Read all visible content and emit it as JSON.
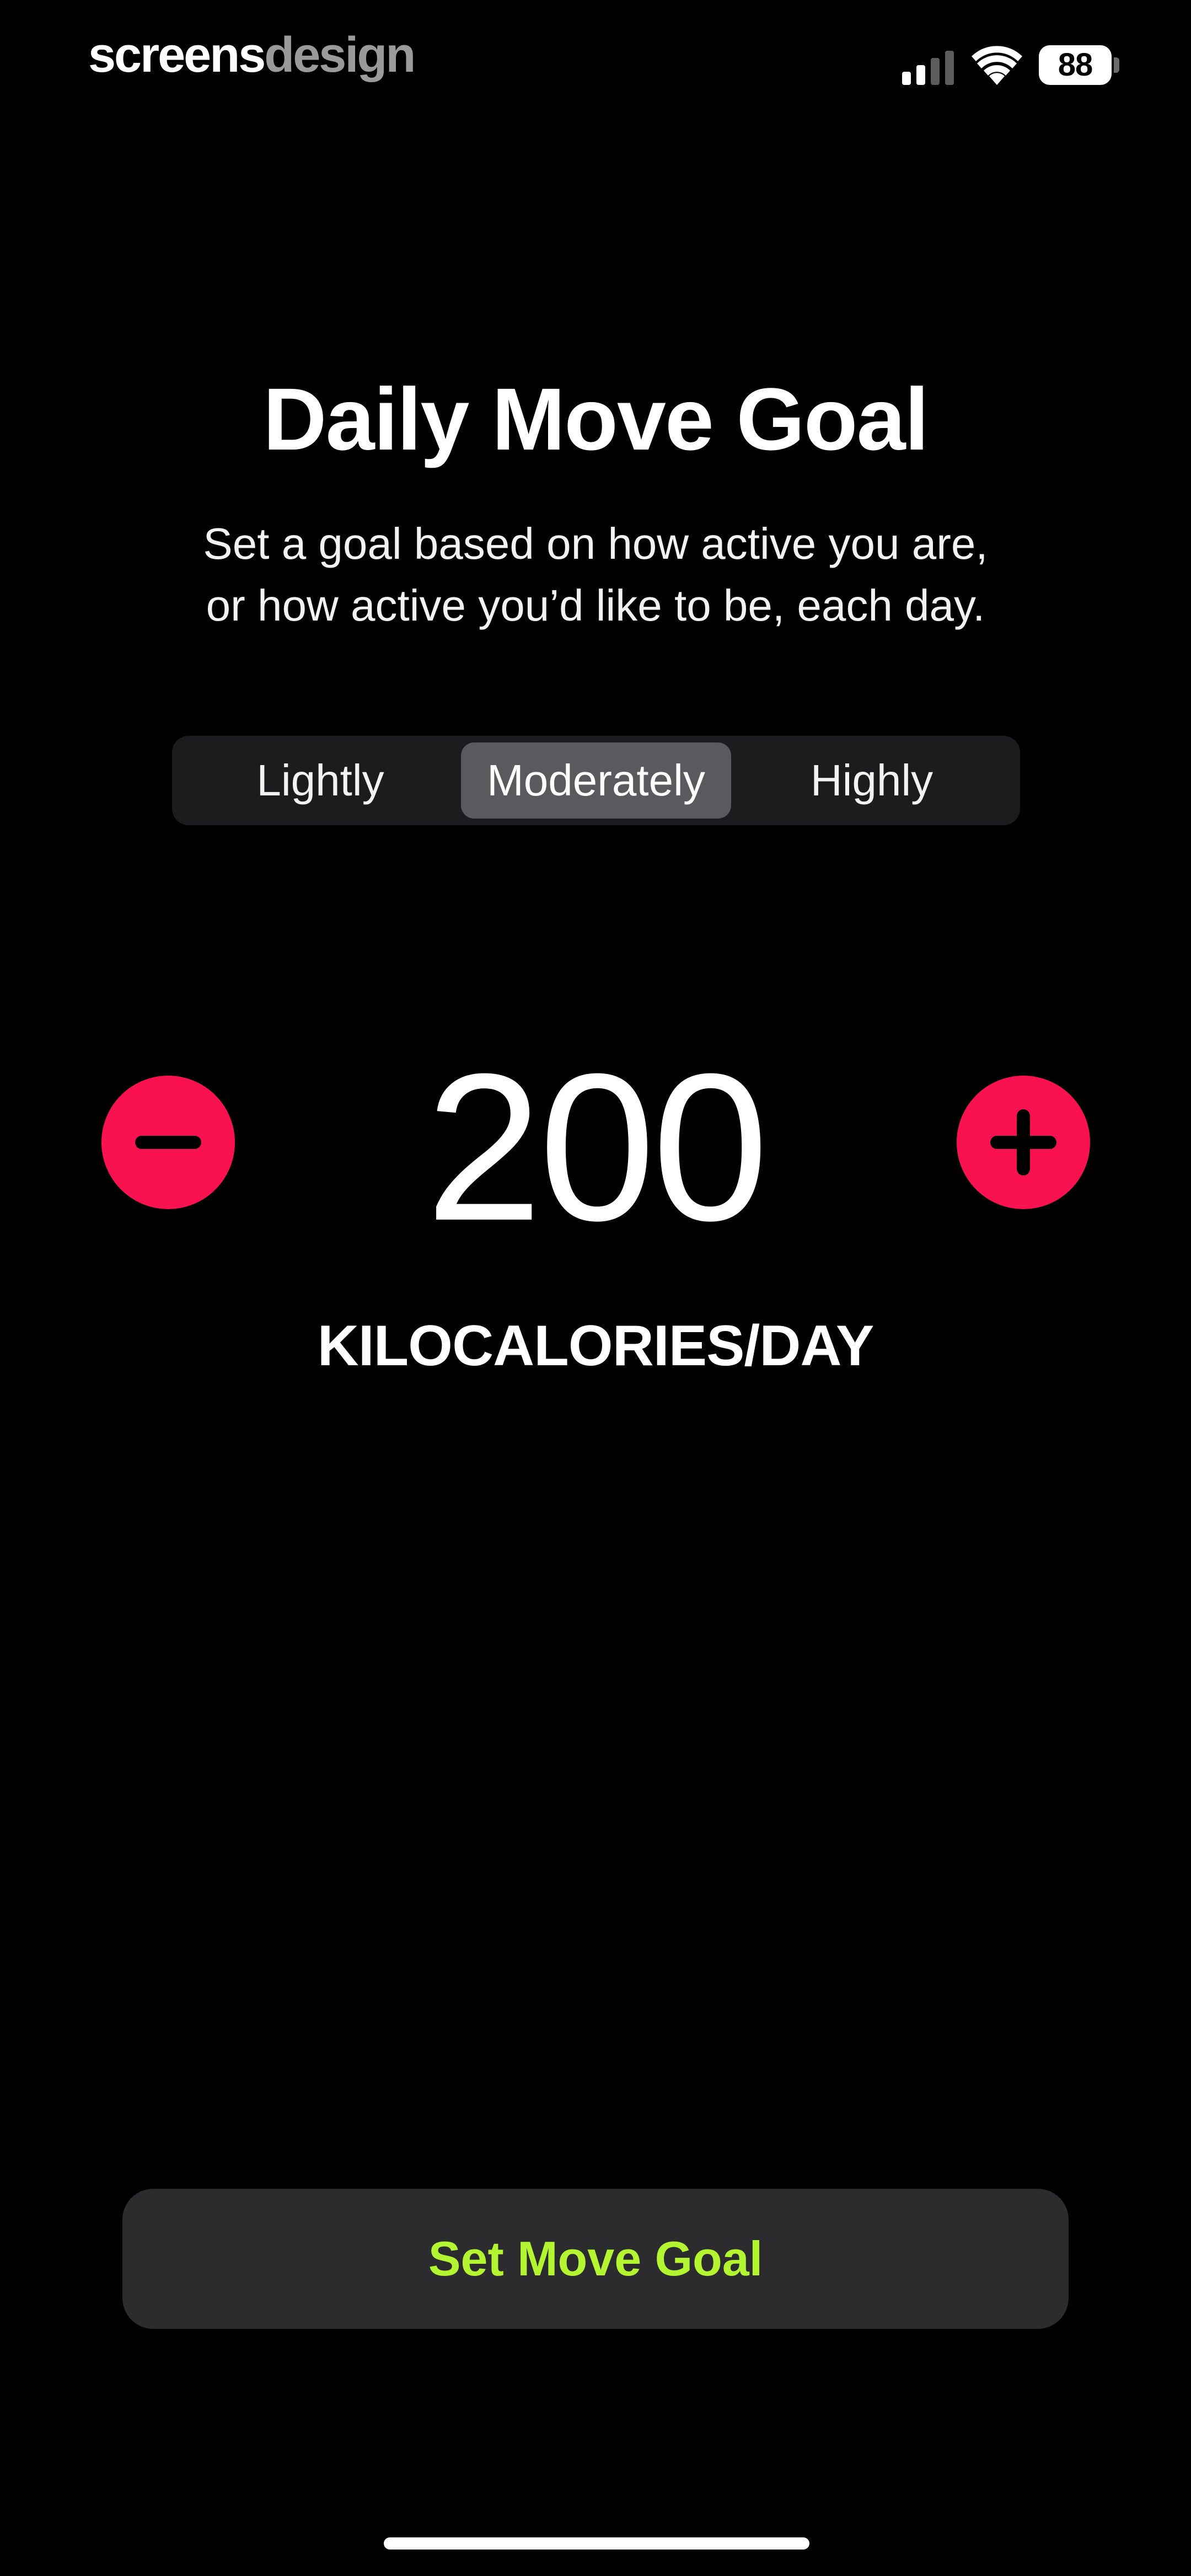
{
  "status_bar": {
    "brand_part1": "screens",
    "brand_part2": "design",
    "battery": "88",
    "icons": [
      "signal-icon",
      "wifi-icon",
      "battery-icon"
    ]
  },
  "header": {
    "title": "Daily Move Goal",
    "subtitle_line1": "Set a goal based on how active you are,",
    "subtitle_line2": "or how active you’d like to be, each day."
  },
  "activity_level": {
    "options": [
      "Lightly",
      "Moderately",
      "Highly"
    ],
    "selected": "Moderately"
  },
  "goal": {
    "value": "200",
    "units": "KILOCALORIES/DAY",
    "decrease_icon": "minus-icon",
    "increase_icon": "plus-icon"
  },
  "actions": {
    "set_goal_label": "Set Move Goal"
  },
  "colors": {
    "background": "#000000",
    "accent_red": "#fa114f",
    "cta_text_green": "#b4f531",
    "segment_bg": "#1c1c1e",
    "segment_selected_bg": "#5a5a5e",
    "button_bg": "#2c2c2e"
  }
}
